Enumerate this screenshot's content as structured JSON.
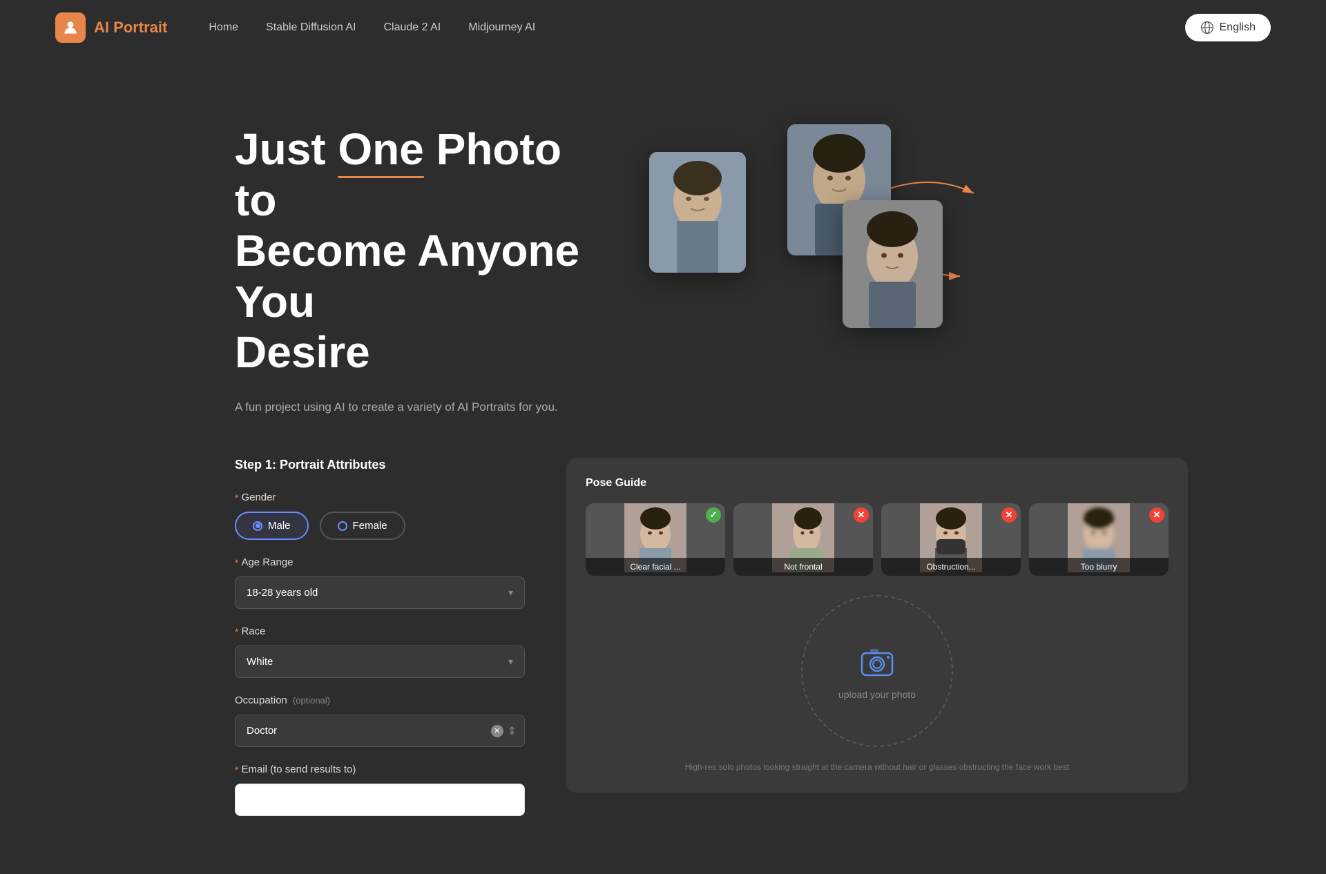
{
  "navbar": {
    "logo_text": "AI Portrait",
    "links": [
      {
        "label": "Home",
        "href": "#"
      },
      {
        "label": "Stable Diffusion AI",
        "href": "#"
      },
      {
        "label": "Claude 2 AI",
        "href": "#"
      },
      {
        "label": "Midjourney AI",
        "href": "#"
      }
    ],
    "language_btn": "English"
  },
  "hero": {
    "title_line1": "Just One Photo to",
    "title_line2": "Become Anyone You",
    "title_line3": "Desire",
    "title_underline_word": "One",
    "subtitle": "A fun project using AI to create a variety of AI Portraits for you."
  },
  "form": {
    "step_title": "Step 1: Portrait Attributes",
    "gender_label": "Gender",
    "gender_options": [
      {
        "id": "male",
        "label": "Male",
        "selected": true
      },
      {
        "id": "female",
        "label": "Female",
        "selected": false
      }
    ],
    "age_range_label": "Age Range",
    "age_range_value": "18-28 years old",
    "race_label": "Race",
    "race_value": "White",
    "occupation_label": "Occupation",
    "occupation_optional": "(optional)",
    "occupation_value": "Doctor",
    "email_label": "Email (to send results to)",
    "email_placeholder": ""
  },
  "pose_guide": {
    "title": "Pose Guide",
    "examples": [
      {
        "label": "Clear facial ...",
        "badge": "✓",
        "badge_type": "check"
      },
      {
        "label": "Not frontal",
        "badge": "✕",
        "badge_type": "x"
      },
      {
        "label": "Obstruction...",
        "badge": "✕",
        "badge_type": "x"
      },
      {
        "label": "Too blurry",
        "badge": "✕",
        "badge_type": "x"
      }
    ],
    "upload_text": "upload your photo",
    "upload_hint": "High-res solo photos looking straight at the camera without hair or glasses obstructing the face work best"
  }
}
